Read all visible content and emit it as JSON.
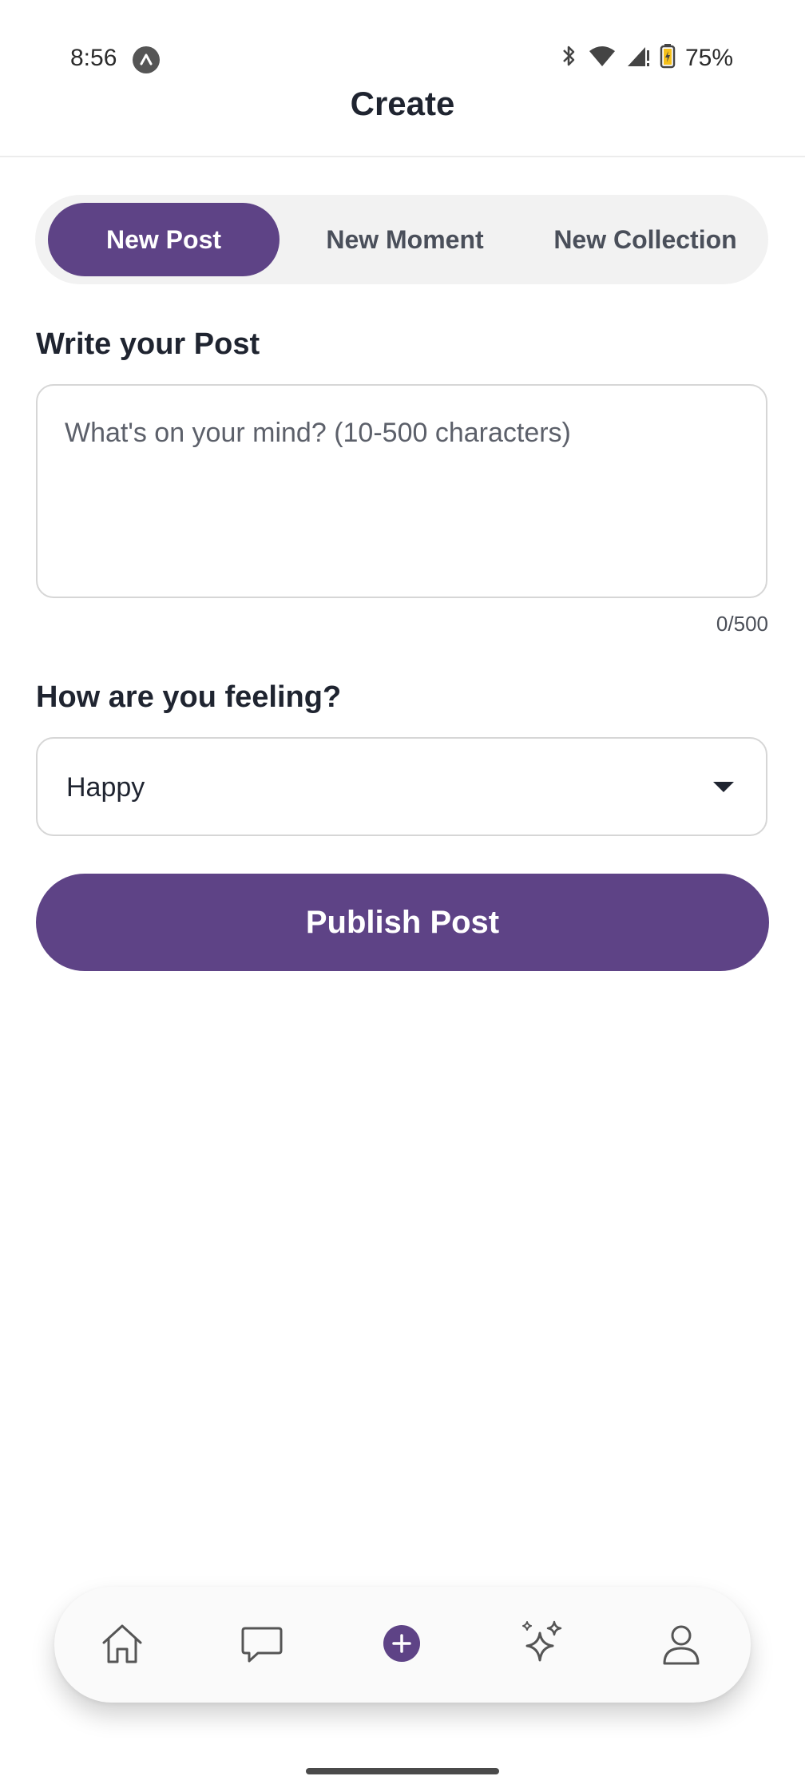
{
  "status_bar": {
    "time": "8:56",
    "battery": "75%"
  },
  "header": {
    "title": "Create"
  },
  "tabs": [
    {
      "label": "New Post",
      "active": true
    },
    {
      "label": "New Moment",
      "active": false
    },
    {
      "label": "New Collection",
      "active": false
    }
  ],
  "post": {
    "label": "Write your Post",
    "value": "",
    "placeholder": "What's on your mind? (10-500 characters)",
    "char_count": "0/500"
  },
  "feeling": {
    "label": "How are you feeling?",
    "selected": "Happy"
  },
  "publish": {
    "label": "Publish Post"
  },
  "bottom_nav": {
    "items": [
      {
        "icon": "home-icon"
      },
      {
        "icon": "chat-icon"
      },
      {
        "icon": "plus-icon",
        "active": true
      },
      {
        "icon": "sparkles-icon"
      },
      {
        "icon": "profile-icon"
      }
    ]
  },
  "colors": {
    "accent": "#5e4386",
    "background": "#ffffff",
    "segment_bg": "#f2f2f2"
  }
}
